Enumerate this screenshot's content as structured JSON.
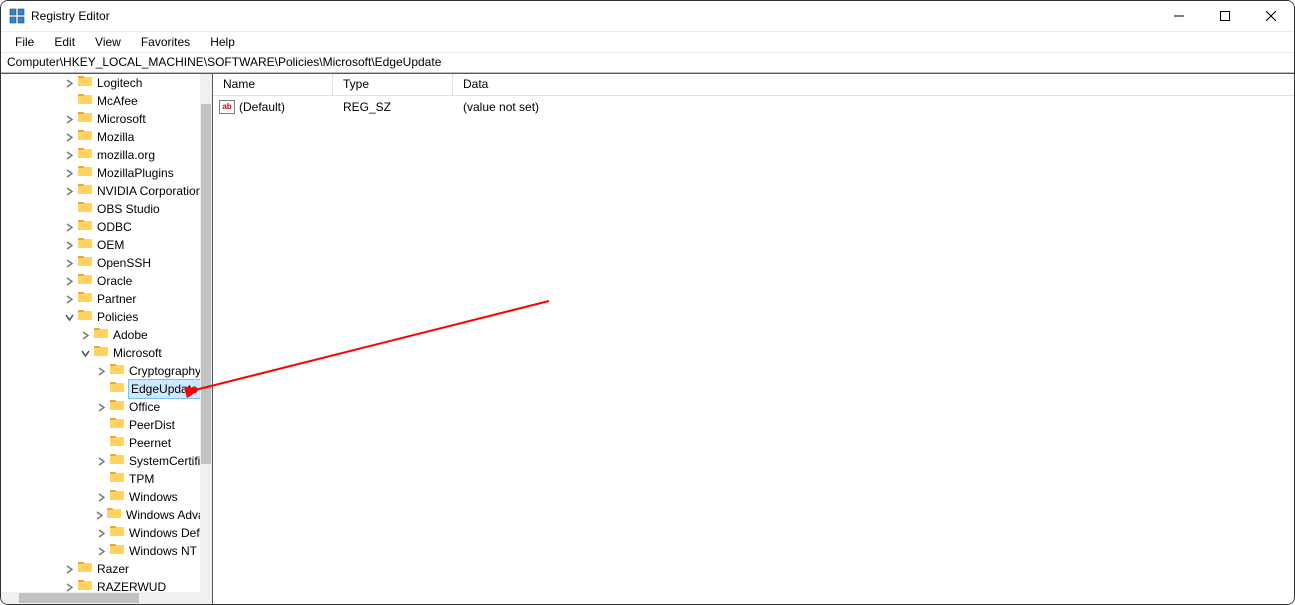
{
  "window": {
    "title": "Registry Editor"
  },
  "menu": {
    "file": "File",
    "edit": "Edit",
    "view": "View",
    "favorites": "Favorites",
    "help": "Help"
  },
  "address": "Computer\\HKEY_LOCAL_MACHINE\\SOFTWARE\\Policies\\Microsoft\\EdgeUpdate",
  "columns": {
    "name": "Name",
    "type": "Type",
    "data": "Data"
  },
  "rows": [
    {
      "name": "(Default)",
      "type": "REG_SZ",
      "data": "(value not set)"
    }
  ],
  "tree": [
    {
      "indent": 2,
      "exp": ">",
      "label": "Logitech"
    },
    {
      "indent": 2,
      "exp": "",
      "label": "McAfee"
    },
    {
      "indent": 2,
      "exp": ">",
      "label": "Microsoft"
    },
    {
      "indent": 2,
      "exp": ">",
      "label": "Mozilla"
    },
    {
      "indent": 2,
      "exp": ">",
      "label": "mozilla.org"
    },
    {
      "indent": 2,
      "exp": ">",
      "label": "MozillaPlugins"
    },
    {
      "indent": 2,
      "exp": ">",
      "label": "NVIDIA Corporation"
    },
    {
      "indent": 2,
      "exp": "",
      "label": "OBS Studio"
    },
    {
      "indent": 2,
      "exp": ">",
      "label": "ODBC"
    },
    {
      "indent": 2,
      "exp": ">",
      "label": "OEM"
    },
    {
      "indent": 2,
      "exp": ">",
      "label": "OpenSSH"
    },
    {
      "indent": 2,
      "exp": ">",
      "label": "Oracle"
    },
    {
      "indent": 2,
      "exp": ">",
      "label": "Partner"
    },
    {
      "indent": 2,
      "exp": "v",
      "label": "Policies"
    },
    {
      "indent": 3,
      "exp": ">",
      "label": "Adobe"
    },
    {
      "indent": 3,
      "exp": "v",
      "label": "Microsoft"
    },
    {
      "indent": 4,
      "exp": ">",
      "label": "Cryptography"
    },
    {
      "indent": 4,
      "exp": "",
      "label": "EdgeUpdate",
      "selected": true
    },
    {
      "indent": 4,
      "exp": ">",
      "label": "Office"
    },
    {
      "indent": 4,
      "exp": "",
      "label": "PeerDist"
    },
    {
      "indent": 4,
      "exp": "",
      "label": "Peernet"
    },
    {
      "indent": 4,
      "exp": ">",
      "label": "SystemCertificates"
    },
    {
      "indent": 4,
      "exp": "",
      "label": "TPM"
    },
    {
      "indent": 4,
      "exp": ">",
      "label": "Windows"
    },
    {
      "indent": 4,
      "exp": ">",
      "label": "Windows Advanced Threat Protection"
    },
    {
      "indent": 4,
      "exp": ">",
      "label": "Windows Defender"
    },
    {
      "indent": 4,
      "exp": ">",
      "label": "Windows NT"
    },
    {
      "indent": 2,
      "exp": ">",
      "label": "Razer"
    },
    {
      "indent": 2,
      "exp": ">",
      "label": "RAZERWUD"
    }
  ]
}
